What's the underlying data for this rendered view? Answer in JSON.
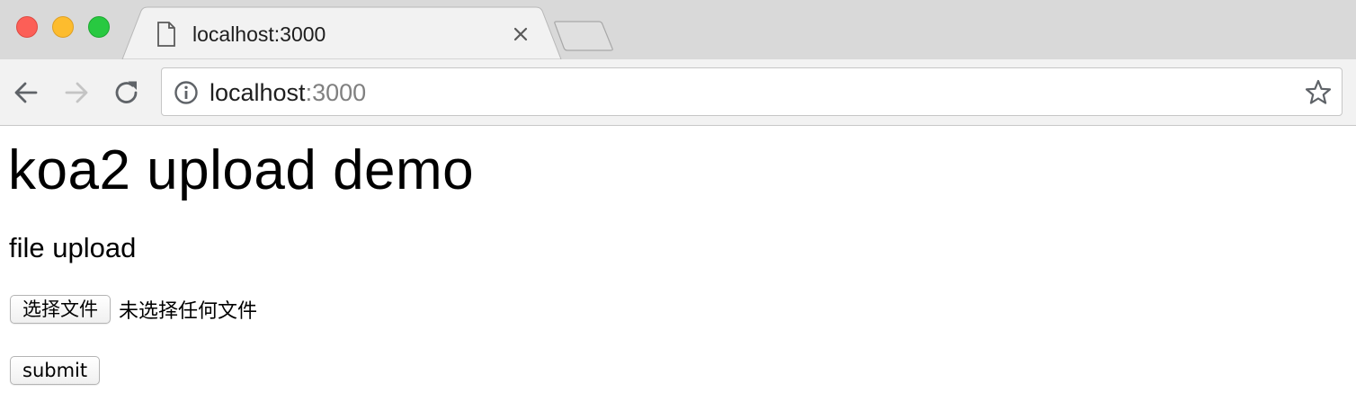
{
  "window": {
    "traffic_lights": [
      "close",
      "minimize",
      "zoom"
    ],
    "colors": {
      "close": "#fc5f57",
      "minimize": "#fdbc2e",
      "zoom": "#28c941"
    }
  },
  "tab": {
    "title": "localhost:3000",
    "icon": "page-icon"
  },
  "toolbar": {
    "url_host": "localhost",
    "url_port": ":3000",
    "icons": [
      "back-arrow-icon",
      "forward-arrow-icon",
      "reload-icon",
      "info-icon",
      "bookmark-star-icon"
    ]
  },
  "page": {
    "title": "koa2 upload demo",
    "section_title": "file upload",
    "file_button_label": "选择文件",
    "file_status": "未选择任何文件",
    "submit_label": "submit"
  }
}
